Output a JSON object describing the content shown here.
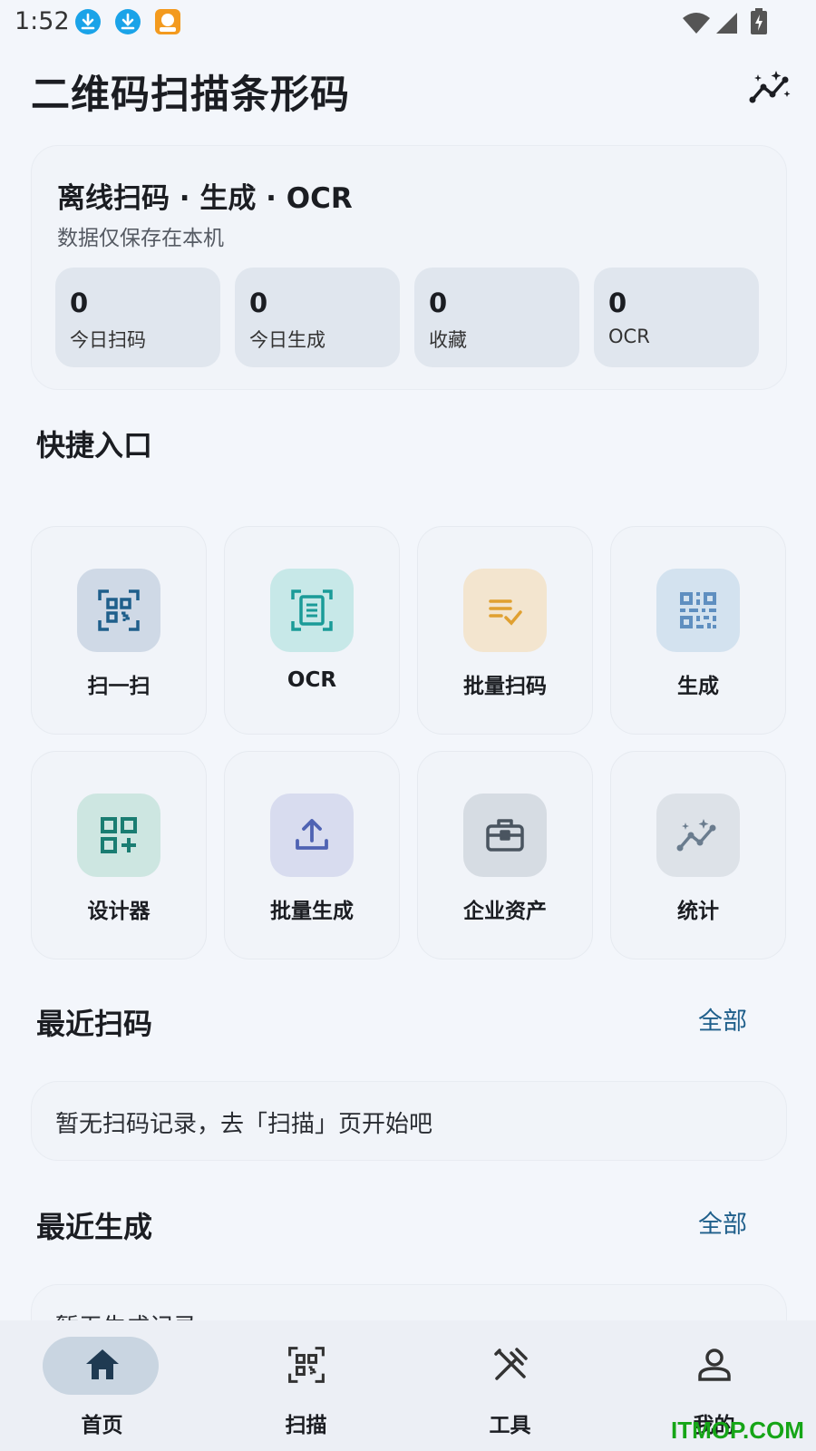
{
  "status_bar": {
    "time": "1:52"
  },
  "header": {
    "title": "二维码扫描条形码",
    "stats_icon": "stats-sparkle-icon"
  },
  "summary": {
    "title": "离线扫码 · 生成 · OCR",
    "subtitle": "数据仅保存在本机",
    "stats": [
      {
        "value": "0",
        "label": "今日扫码"
      },
      {
        "value": "0",
        "label": "今日生成"
      },
      {
        "value": "0",
        "label": "收藏"
      },
      {
        "value": "0",
        "label": "OCR"
      }
    ]
  },
  "quick": {
    "title": "快捷入口",
    "items": [
      {
        "label": "扫一扫",
        "icon": "qr-scan-icon",
        "bg": "#cfd9e6",
        "color": "#1f5f8b"
      },
      {
        "label": "OCR",
        "icon": "document-scan-icon",
        "bg": "#c7e8e8",
        "color": "#1a9b98"
      },
      {
        "label": "批量扫码",
        "icon": "batch-list-icon",
        "bg": "#f3e5cf",
        "color": "#e0a030"
      },
      {
        "label": "生成",
        "icon": "qr-code-icon",
        "bg": "#d3e2ef",
        "color": "#5f8fc0"
      },
      {
        "label": "设计器",
        "icon": "qr-add-icon",
        "bg": "#cde6e1",
        "color": "#1a7d72"
      },
      {
        "label": "批量生成",
        "icon": "upload-icon",
        "bg": "#d8dcef",
        "color": "#4f63b3"
      },
      {
        "label": "企业资产",
        "icon": "briefcase-icon",
        "bg": "#d6dce3",
        "color": "#4a5560"
      },
      {
        "label": "统计",
        "icon": "stats-sparkle-icon",
        "bg": "#dde2e8",
        "color": "#6a7c8e"
      }
    ]
  },
  "recent_scan": {
    "title": "最近扫码",
    "see_all": "全部",
    "empty": "暂无扫码记录，去「扫描」页开始吧"
  },
  "recent_gen": {
    "title": "最近生成",
    "see_all": "全部",
    "empty": "暂无生成记录"
  },
  "nav": {
    "items": [
      {
        "label": "首页",
        "icon": "home-icon",
        "active": true
      },
      {
        "label": "扫描",
        "icon": "qr-scan-icon",
        "active": false
      },
      {
        "label": "工具",
        "icon": "tools-icon",
        "active": false
      },
      {
        "label": "我的",
        "icon": "person-icon",
        "active": false
      }
    ]
  },
  "watermark": "ITMOP.COM"
}
